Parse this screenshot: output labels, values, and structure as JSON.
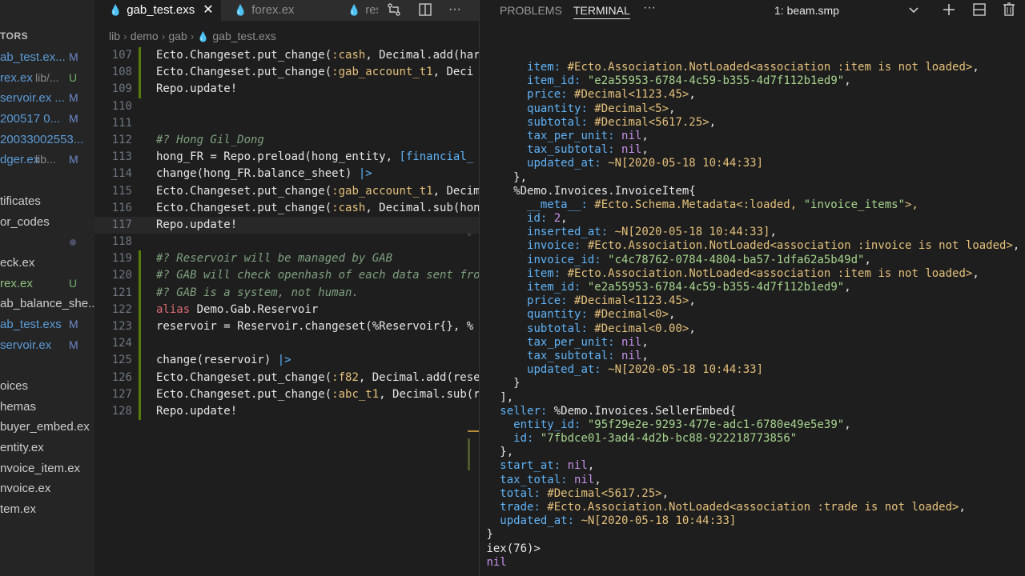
{
  "sidebar": {
    "header": "TORS",
    "items": [
      {
        "name": "ab_test.ex...",
        "color": "#5b9bd5",
        "path": "",
        "badge": "M",
        "badge_color": "#6c87c7"
      },
      {
        "name": "rex.ex",
        "color": "#5b9bd5",
        "path": "lib/...",
        "badge": "U",
        "badge_color": "#73b06c"
      },
      {
        "name": "servoir.ex ...",
        "color": "#5b9bd5",
        "path": "",
        "badge": "M",
        "badge_color": "#6c87c7"
      },
      {
        "name": "200517 0...",
        "color": "#5b9bd5",
        "path": "",
        "badge": "M",
        "badge_color": "#6c87c7"
      },
      {
        "name": "20033002553...",
        "color": "#5b9bd5",
        "path": "",
        "badge": "",
        "badge_color": ""
      },
      {
        "name": "dger.ex",
        "color": "#5b9bd5",
        "path": "lib...",
        "badge": "M",
        "badge_color": "#6c87c7"
      },
      {
        "name": "",
        "color": "#cccccc",
        "path": "",
        "badge": "",
        "badge_color": ""
      },
      {
        "name": "tificates",
        "color": "#cccccc",
        "path": "",
        "badge": "",
        "badge_color": ""
      },
      {
        "name": "or_codes",
        "color": "#cccccc",
        "path": "",
        "badge": "",
        "badge_color": ""
      },
      {
        "name": "",
        "color": "#cccccc",
        "path": "",
        "badge": "",
        "badge_color": "",
        "dot": true
      },
      {
        "name": "eck.ex",
        "color": "#cccccc",
        "path": "",
        "badge": "",
        "badge_color": ""
      },
      {
        "name": "rex.ex",
        "color": "#8fc27a",
        "path": "",
        "badge": "U",
        "badge_color": "#73b06c"
      },
      {
        "name": "ab_balance_she...",
        "color": "#cccccc",
        "path": "",
        "badge": "",
        "badge_color": ""
      },
      {
        "name": "ab_test.exs",
        "color": "#5b9bd5",
        "path": "",
        "badge": "M",
        "badge_color": "#6c87c7"
      },
      {
        "name": "servoir.ex",
        "color": "#5b9bd5",
        "path": "",
        "badge": "M",
        "badge_color": "#6c87c7"
      },
      {
        "name": "",
        "color": "#cccccc",
        "path": "",
        "badge": "",
        "badge_color": ""
      },
      {
        "name": "oices",
        "color": "#cccccc",
        "path": "",
        "badge": "",
        "badge_color": ""
      },
      {
        "name": "hemas",
        "color": "#cccccc",
        "path": "",
        "badge": "",
        "badge_color": ""
      },
      {
        "name": "buyer_embed.ex",
        "color": "#cccccc",
        "path": "",
        "badge": "",
        "badge_color": ""
      },
      {
        "name": "entity.ex",
        "color": "#cccccc",
        "path": "",
        "badge": "",
        "badge_color": ""
      },
      {
        "name": "nvoice_item.ex",
        "color": "#cccccc",
        "path": "",
        "badge": "",
        "badge_color": ""
      },
      {
        "name": "nvoice.ex",
        "color": "#cccccc",
        "path": "",
        "badge": "",
        "badge_color": ""
      },
      {
        "name": "tem.ex",
        "color": "#cccccc",
        "path": "",
        "badge": "",
        "badge_color": ""
      }
    ]
  },
  "editor": {
    "tabs": [
      {
        "label": "gab_test.exs",
        "active": true,
        "icon": "elixir-drop-icon"
      },
      {
        "label": "forex.ex",
        "active": false,
        "icon": "elixir-drop-icon"
      },
      {
        "label": "res",
        "active": false,
        "icon": "elixir-drop-icon"
      }
    ],
    "breadcrumb": [
      "lib",
      "demo",
      "gab",
      "gab_test.exs"
    ],
    "lines": [
      {
        "n": "107",
        "g": "add",
        "cur": false,
        "t": [
          [
            "Ecto.Changeset.put_change(",
            "t-fn"
          ],
          [
            ":cash",
            "t-at"
          ],
          [
            ", Decimal.add(har",
            "t-fn"
          ]
        ]
      },
      {
        "n": "108",
        "g": "add",
        "cur": false,
        "t": [
          [
            "Ecto.Changeset.put_change(",
            "t-fn"
          ],
          [
            ":gab_account_t1",
            "t-at"
          ],
          [
            ", Deci",
            "t-fn"
          ]
        ]
      },
      {
        "n": "109",
        "g": "add",
        "cur": false,
        "t": [
          [
            "Repo.update!",
            "t-fn"
          ]
        ]
      },
      {
        "n": "110",
        "g": "",
        "cur": false,
        "t": []
      },
      {
        "n": "111",
        "g": "",
        "cur": false,
        "t": []
      },
      {
        "n": "112",
        "g": "",
        "cur": false,
        "t": [
          [
            "#? Hong Gil_Dong",
            "t-cm"
          ]
        ]
      },
      {
        "n": "113",
        "g": "",
        "cur": false,
        "t": [
          [
            "hong_FR = Repo.preload(hong_entity, ",
            "t-fn"
          ],
          [
            "[financial_",
            "t-bl"
          ]
        ]
      },
      {
        "n": "114",
        "g": "",
        "cur": false,
        "t": [
          [
            "change(hong_FR.balance_sheet) ",
            "t-fn"
          ],
          [
            "|>",
            "t-bl"
          ]
        ]
      },
      {
        "n": "115",
        "g": "",
        "cur": false,
        "t": [
          [
            "Ecto.Changeset.put_change(",
            "t-fn"
          ],
          [
            ":gab_account_t1",
            "t-at"
          ],
          [
            ", Decim",
            "t-fn"
          ]
        ]
      },
      {
        "n": "116",
        "g": "",
        "cur": false,
        "t": [
          [
            "Ecto.Changeset.put_change(",
            "t-fn"
          ],
          [
            ":cash",
            "t-at"
          ],
          [
            ", Decimal.sub(hon",
            "t-fn"
          ]
        ]
      },
      {
        "n": "117",
        "g": "",
        "cur": true,
        "t": [
          [
            "Repo.update!",
            "t-fn"
          ]
        ]
      },
      {
        "n": "118",
        "g": "",
        "cur": false,
        "t": []
      },
      {
        "n": "119",
        "g": "add",
        "cur": false,
        "t": [
          [
            "#? Reservoir will be managed by GAB",
            "t-cm"
          ]
        ]
      },
      {
        "n": "120",
        "g": "add",
        "cur": false,
        "t": [
          [
            "#? GAB will check openhash of each data sent fro",
            "t-cm"
          ]
        ]
      },
      {
        "n": "121",
        "g": "add",
        "cur": false,
        "t": [
          [
            "#? GAB is a system, not human.",
            "t-cm"
          ]
        ]
      },
      {
        "n": "122",
        "g": "add",
        "cur": false,
        "t": [
          [
            "alias",
            "t-kw"
          ],
          [
            " Demo.Gab.Reservoir",
            "t-fn"
          ]
        ]
      },
      {
        "n": "123",
        "g": "add",
        "cur": false,
        "t": [
          [
            "reservoir = Reservoir.changeset(%Reservoir{}, %",
            "t-fn"
          ]
        ]
      },
      {
        "n": "124",
        "g": "add",
        "cur": false,
        "t": []
      },
      {
        "n": "125",
        "g": "add",
        "cur": false,
        "t": [
          [
            "change(reservoir) ",
            "t-fn"
          ],
          [
            "|>",
            "t-bl"
          ]
        ]
      },
      {
        "n": "126",
        "g": "add",
        "cur": false,
        "t": [
          [
            "Ecto.Changeset.put_change(",
            "t-fn"
          ],
          [
            ":f82",
            "t-at"
          ],
          [
            ", Decimal.add(rese",
            "t-fn"
          ]
        ]
      },
      {
        "n": "127",
        "g": "add",
        "cur": false,
        "t": [
          [
            "Ecto.Changeset.put_change(",
            "t-fn"
          ],
          [
            ":abc_t1",
            "t-at"
          ],
          [
            ", Decimal.sub(r",
            "t-fn"
          ]
        ]
      },
      {
        "n": "128",
        "g": "add",
        "cur": false,
        "t": [
          [
            "Repo.update!",
            "t-fn"
          ]
        ]
      }
    ]
  },
  "panel": {
    "tabs": [
      "PROBLEMS",
      "TERMINAL"
    ],
    "more": "···",
    "terminal_select": "1: beam.smp",
    "lines": [
      [
        [
          "      ",
          "w"
        ],
        [
          "item:",
          "k"
        ],
        [
          " #Ecto.Association.NotLoaded<association :item is not loaded>",
          "o"
        ],
        [
          ",",
          "w"
        ]
      ],
      [
        [
          "      ",
          "w"
        ],
        [
          "item_id:",
          "k"
        ],
        [
          " \"e2a55953-6784-4c59-b355-4d7f112b1ed9\"",
          "s"
        ],
        [
          ",",
          "w"
        ]
      ],
      [
        [
          "      ",
          "w"
        ],
        [
          "price:",
          "k"
        ],
        [
          " #Decimal<1123.45>",
          "o"
        ],
        [
          ",",
          "w"
        ]
      ],
      [
        [
          "      ",
          "w"
        ],
        [
          "quantity:",
          "k"
        ],
        [
          " #Decimal<5>",
          "o"
        ],
        [
          ",",
          "w"
        ]
      ],
      [
        [
          "      ",
          "w"
        ],
        [
          "subtotal:",
          "k"
        ],
        [
          " #Decimal<5617.25>",
          "o"
        ],
        [
          ",",
          "w"
        ]
      ],
      [
        [
          "      ",
          "w"
        ],
        [
          "tax_per_unit:",
          "k"
        ],
        [
          " nil",
          "n"
        ],
        [
          ",",
          "w"
        ]
      ],
      [
        [
          "      ",
          "w"
        ],
        [
          "tax_subtotal:",
          "k"
        ],
        [
          " nil",
          "n"
        ],
        [
          ",",
          "w"
        ]
      ],
      [
        [
          "      ",
          "w"
        ],
        [
          "updated_at:",
          "k"
        ],
        [
          " ~N[2020-05-18 10:44:33]",
          "o"
        ]
      ],
      [
        [
          "    },",
          "w"
        ]
      ],
      [
        [
          "    %Demo.Invoices.InvoiceItem{",
          "w"
        ]
      ],
      [
        [
          "      ",
          "w"
        ],
        [
          "__meta__:",
          "k"
        ],
        [
          " #Ecto.Schema.Metadata<:loaded, ",
          "o"
        ],
        [
          "\"invoice_items\"",
          "s"
        ],
        [
          ">,",
          "o"
        ]
      ],
      [
        [
          "      ",
          "w"
        ],
        [
          "id:",
          "k"
        ],
        [
          " 2",
          "n"
        ],
        [
          ",",
          "w"
        ]
      ],
      [
        [
          "      ",
          "w"
        ],
        [
          "inserted_at:",
          "k"
        ],
        [
          " ~N[2020-05-18 10:44:33]",
          "o"
        ],
        [
          ",",
          "w"
        ]
      ],
      [
        [
          "      ",
          "w"
        ],
        [
          "invoice:",
          "k"
        ],
        [
          " #Ecto.Association.NotLoaded<association :invoice is not loaded>",
          "o"
        ],
        [
          ",",
          "w"
        ]
      ],
      [
        [
          "      ",
          "w"
        ],
        [
          "invoice_id:",
          "k"
        ],
        [
          " \"c4c78762-0784-4804-ba57-1dfa62a5b49d\"",
          "s"
        ],
        [
          ",",
          "w"
        ]
      ],
      [
        [
          "      ",
          "w"
        ],
        [
          "item:",
          "k"
        ],
        [
          " #Ecto.Association.NotLoaded<association :item is not loaded>",
          "o"
        ],
        [
          ",",
          "w"
        ]
      ],
      [
        [
          "      ",
          "w"
        ],
        [
          "item_id:",
          "k"
        ],
        [
          " \"e2a55953-6784-4c59-b355-4d7f112b1ed9\"",
          "s"
        ],
        [
          ",",
          "w"
        ]
      ],
      [
        [
          "      ",
          "w"
        ],
        [
          "price:",
          "k"
        ],
        [
          " #Decimal<1123.45>",
          "o"
        ],
        [
          ",",
          "w"
        ]
      ],
      [
        [
          "      ",
          "w"
        ],
        [
          "quantity:",
          "k"
        ],
        [
          " #Decimal<0>",
          "o"
        ],
        [
          ",",
          "w"
        ]
      ],
      [
        [
          "      ",
          "w"
        ],
        [
          "subtotal:",
          "k"
        ],
        [
          " #Decimal<0.00>",
          "o"
        ],
        [
          ",",
          "w"
        ]
      ],
      [
        [
          "      ",
          "w"
        ],
        [
          "tax_per_unit:",
          "k"
        ],
        [
          " nil",
          "n"
        ],
        [
          ",",
          "w"
        ]
      ],
      [
        [
          "      ",
          "w"
        ],
        [
          "tax_subtotal:",
          "k"
        ],
        [
          " nil",
          "n"
        ],
        [
          ",",
          "w"
        ]
      ],
      [
        [
          "      ",
          "w"
        ],
        [
          "updated_at:",
          "k"
        ],
        [
          " ~N[2020-05-18 10:44:33]",
          "o"
        ]
      ],
      [
        [
          "    }",
          "w"
        ]
      ],
      [
        [
          "  ],",
          "w"
        ]
      ],
      [
        [
          "  ",
          "w"
        ],
        [
          "seller:",
          "k"
        ],
        [
          " %Demo.Invoices.SellerEmbed{",
          "w"
        ]
      ],
      [
        [
          "    ",
          "w"
        ],
        [
          "entity_id:",
          "k"
        ],
        [
          " \"95f29e2e-9293-477e-adc1-6780e49e5e39\"",
          "s"
        ],
        [
          ",",
          "w"
        ]
      ],
      [
        [
          "    ",
          "w"
        ],
        [
          "id:",
          "k"
        ],
        [
          " \"7fbdce01-3ad4-4d2b-bc88-922218773856\"",
          "s"
        ]
      ],
      [
        [
          "  },",
          "w"
        ]
      ],
      [
        [
          "  ",
          "w"
        ],
        [
          "start_at:",
          "k"
        ],
        [
          " nil",
          "n"
        ],
        [
          ",",
          "w"
        ]
      ],
      [
        [
          "  ",
          "w"
        ],
        [
          "tax_total:",
          "k"
        ],
        [
          " nil",
          "n"
        ],
        [
          ",",
          "w"
        ]
      ],
      [
        [
          "  ",
          "w"
        ],
        [
          "total:",
          "k"
        ],
        [
          " #Decimal<5617.25>",
          "o"
        ],
        [
          ",",
          "w"
        ]
      ],
      [
        [
          "  ",
          "w"
        ],
        [
          "trade:",
          "k"
        ],
        [
          " #Ecto.Association.NotLoaded<association :trade is not loaded>",
          "o"
        ],
        [
          ",",
          "w"
        ]
      ],
      [
        [
          "  ",
          "w"
        ],
        [
          "updated_at:",
          "k"
        ],
        [
          " ~N[2020-05-18 10:44:33]",
          "o"
        ]
      ],
      [
        [
          "}",
          "w"
        ]
      ],
      [
        [
          "iex(76)>",
          "w"
        ]
      ],
      [
        [
          "nil",
          "n"
        ]
      ]
    ]
  }
}
